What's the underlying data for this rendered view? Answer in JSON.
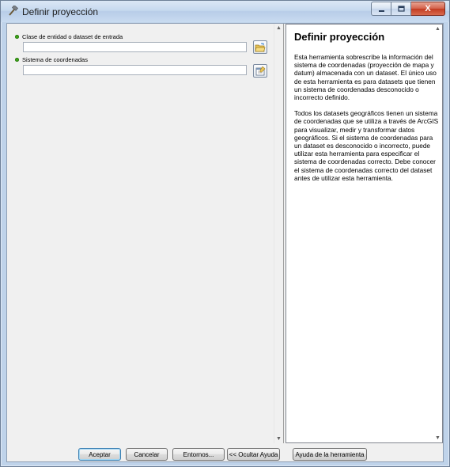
{
  "window": {
    "title": "Definir proyección",
    "controls": {
      "minimize": "-",
      "maximize": "□",
      "close": "X"
    }
  },
  "parameters": [
    {
      "label": "Clase de entidad o dataset de entrada",
      "value": "",
      "icon": "open-folder-icon"
    },
    {
      "label": "Sistema de coordenadas",
      "value": "",
      "icon": "spatial-reference-properties-icon"
    }
  ],
  "help": {
    "title": "Definir proyección",
    "paragraphs": [
      "Esta herramienta sobrescribe la información del sistema de coordenadas (proyección de mapa y datum) almacenada con un dataset. El único uso de esta herramienta es para datasets que tienen un sistema de coordenadas desconocido o incorrecto definido.",
      "Todos los datasets geográficos tienen un sistema de coordenadas que se utiliza a través de ArcGIS para visualizar, medir y transformar datos geográficos. Si el sistema de coordenadas para un dataset es desconocido o incorrecto, puede utilizar esta herramienta para especificar el sistema de coordenadas correcto. Debe conocer el sistema de coordenadas correcto del dataset antes de utilizar esta herramienta."
    ]
  },
  "buttons": {
    "ok": "Aceptar",
    "cancel": "Cancelar",
    "environments": "Entornos...",
    "hide_help": "<< Ocultar Ayuda",
    "tool_help": "Ayuda de la herramienta"
  },
  "colors": {
    "required_indicator": "#3ea61b",
    "titlebar": "#c6d9ef",
    "close_button": "#c23b21"
  }
}
